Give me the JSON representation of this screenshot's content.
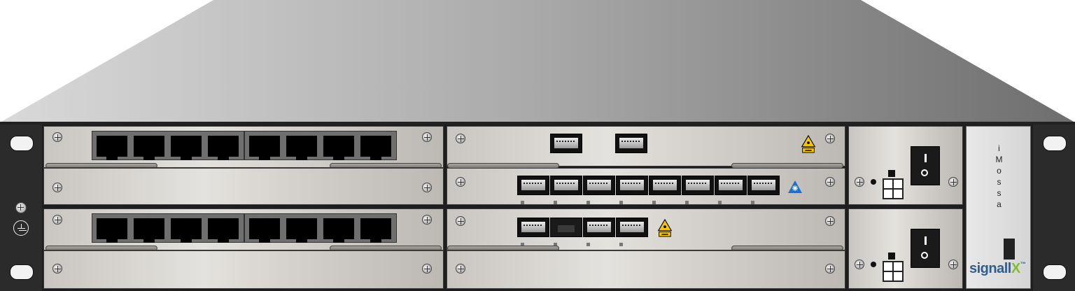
{
  "device": {
    "brand_vertical_letters": [
      "i",
      "M",
      "o",
      "s",
      "s",
      "a"
    ],
    "logo_text": "signall",
    "logo_x": "X",
    "logo_tm": "™"
  },
  "colors": {
    "chassis_dark": "#2b2b2b",
    "module_light": "#e4e2de",
    "port_black": "#000000",
    "warning_yellow": "#f5c400",
    "blue_triangle": "#1c6fd1",
    "logo_blue": "#2f5f8f",
    "logo_green": "#7fbf2f"
  },
  "icons": {
    "ground": "ground-icon",
    "screw": "screw-icon",
    "laser_warning": "laser-warning-icon",
    "power_switch": "power-switch-icon"
  }
}
